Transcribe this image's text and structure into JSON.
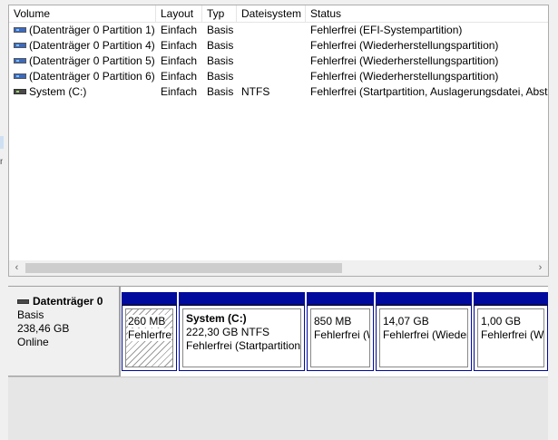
{
  "columns": [
    "Volume",
    "Layout",
    "Typ",
    "Dateisystem",
    "Status"
  ],
  "volumes": [
    {
      "name": "(Datenträger 0 Partition 1)",
      "layout": "Einfach",
      "typ": "Basis",
      "fs": "",
      "status": "Fehlerfrei (EFI-Systempartition)",
      "icon": "volume-icon"
    },
    {
      "name": "(Datenträger 0 Partition 4)",
      "layout": "Einfach",
      "typ": "Basis",
      "fs": "",
      "status": "Fehlerfrei (Wiederherstellungspartition)",
      "icon": "volume-icon"
    },
    {
      "name": "(Datenträger 0 Partition 5)",
      "layout": "Einfach",
      "typ": "Basis",
      "fs": "",
      "status": "Fehlerfrei (Wiederherstellungspartition)",
      "icon": "volume-icon"
    },
    {
      "name": "(Datenträger 0 Partition 6)",
      "layout": "Einfach",
      "typ": "Basis",
      "fs": "",
      "status": "Fehlerfrei (Wiederherstellungspartition)",
      "icon": "volume-icon"
    },
    {
      "name": "System (C:)",
      "layout": "Einfach",
      "typ": "Basis",
      "fs": "NTFS",
      "status": "Fehlerfrei (Startpartition, Auslagerungsdatei, Abstu",
      "icon": "system-volume-icon"
    }
  ],
  "scroll": {
    "left_arrow": "‹",
    "right_arrow": "›"
  },
  "disk": {
    "title": "Datenträger 0",
    "type": "Basis",
    "size": "238,46 GB",
    "state": "Online"
  },
  "partitions": [
    {
      "size": "260 MB",
      "status": "Fehlerfre",
      "hatched": true
    },
    {
      "title": "System  (C:)",
      "size": "222,30 GB NTFS",
      "status": "Fehlerfrei (Startpartition"
    },
    {
      "size": "850 MB",
      "status": "Fehlerfrei (W"
    },
    {
      "size": "14,07 GB",
      "status": "Fehlerfrei (Wieder"
    },
    {
      "size": "1,00 GB",
      "status": "Fehlerfrei (W"
    }
  ],
  "left_edge_char": "n",
  "colors": {
    "partition_bar": "#000a9c",
    "background": "#f0f0f0"
  }
}
